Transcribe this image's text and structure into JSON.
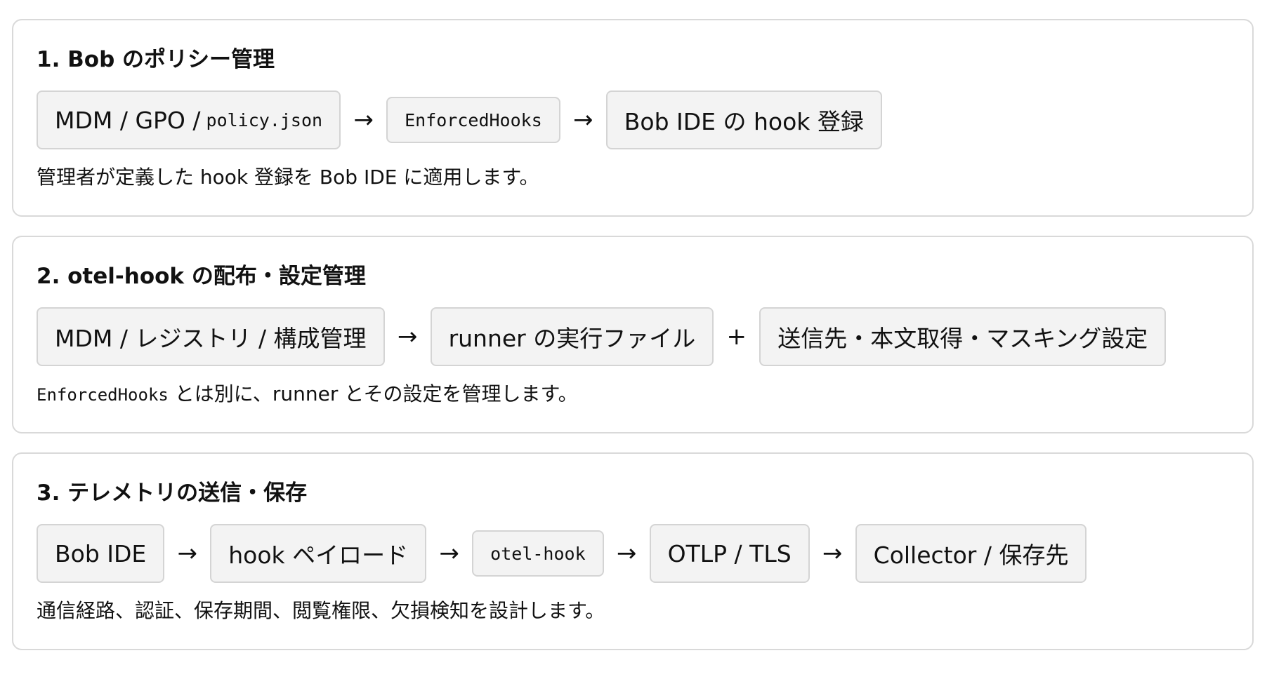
{
  "sections": [
    {
      "title": "1. Bob のポリシー管理",
      "flow": {
        "node1_text": "MDM / GPO / ",
        "node1_code": "policy.json",
        "arrow1": "→",
        "node2_code": "EnforcedHooks",
        "arrow2": "→",
        "node3_text": "Bob IDE の hook 登録"
      },
      "description": "管理者が定義した hook 登録を Bob IDE に適用します。"
    },
    {
      "title": "2. otel-hook の配布・設定管理",
      "flow": {
        "node1_text": "MDM / レジストリ / 構成管理",
        "arrow1": "→",
        "node2_text": "runner の実行ファイル",
        "plus": "+",
        "node3_text": "送信先・本文取得・マスキング設定"
      },
      "description_code": "EnforcedHooks",
      "description": " とは別に、runner とその設定を管理します。"
    },
    {
      "title": "3. テレメトリの送信・保存",
      "flow": {
        "node1_text": "Bob IDE",
        "arrow1": "→",
        "node2_text": "hook ペイロード",
        "arrow2": "→",
        "node3_code": "otel-hook",
        "arrow3": "→",
        "node4_text": "OTLP / TLS",
        "arrow4": "→",
        "node5_text": "Collector / 保存先"
      },
      "description": "通信経路、認証、保存期間、閲覧権限、欠損検知を設計します。"
    }
  ]
}
